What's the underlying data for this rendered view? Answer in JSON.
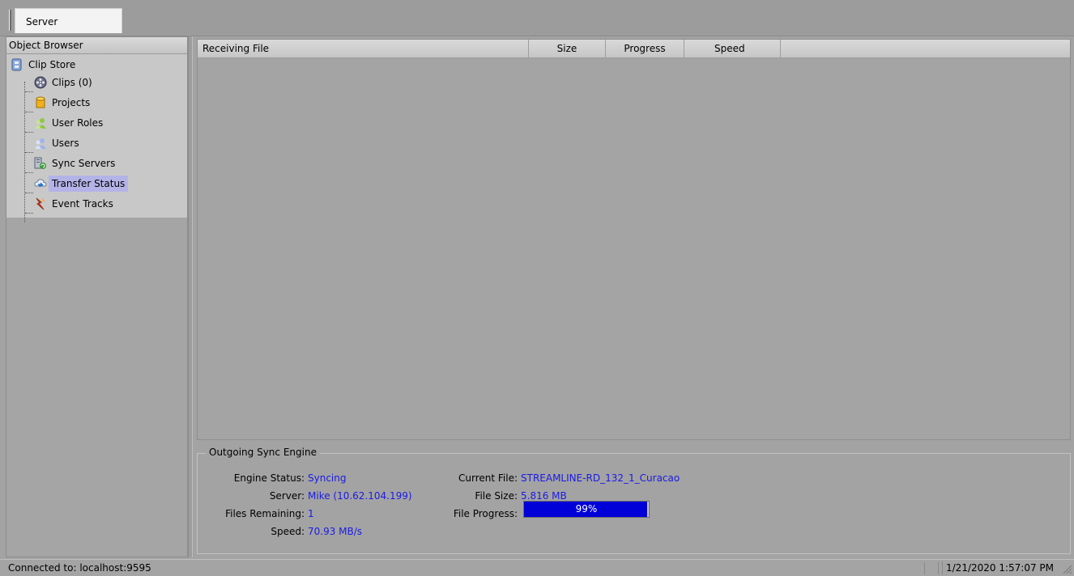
{
  "tabs": [
    {
      "label": "Server"
    }
  ],
  "sidebar": {
    "header": "Object Browser",
    "root": {
      "label": "Clip Store",
      "icon": "clip-store-icon"
    },
    "items": [
      {
        "label": "Clips (0)",
        "icon": "film-reel-icon"
      },
      {
        "label": "Projects",
        "icon": "database-icon"
      },
      {
        "label": "User Roles",
        "icon": "user-roles-icon"
      },
      {
        "label": "Users",
        "icon": "users-icon"
      },
      {
        "label": "Sync Servers",
        "icon": "sync-servers-icon"
      },
      {
        "label": "Transfer Status",
        "icon": "transfer-status-icon",
        "selected": true
      },
      {
        "label": "Event Tracks",
        "icon": "event-tracks-icon"
      }
    ]
  },
  "table": {
    "columns": [
      "Receiving File",
      "Size",
      "Progress",
      "Speed"
    ],
    "rows": []
  },
  "sync_engine": {
    "title": "Outgoing Sync Engine",
    "engine_status_label": "Engine Status:",
    "engine_status": "Syncing",
    "server_label": "Server:",
    "server": "Mike (10.62.104.199)",
    "files_remaining_label": "Files Remaining:",
    "files_remaining": "1",
    "speed_label": "Speed:",
    "speed": "70.93 MB/s",
    "current_file_label": "Current File:",
    "current_file": "STREAMLINE-RD_132_1_Curacao",
    "file_size_label": "File Size:",
    "file_size": "5.816 MB",
    "file_progress_label": "File Progress:",
    "file_progress_text": "99%",
    "file_progress_fraction": 0.99
  },
  "statusbar": {
    "connection": "Connected to: localhost:9595",
    "datetime": "1/21/2020 1:57:07 PM"
  },
  "colors": {
    "value_text": "#1a1ae6",
    "progress_fill": "#0000d8",
    "selection": "#b3b3e8"
  }
}
